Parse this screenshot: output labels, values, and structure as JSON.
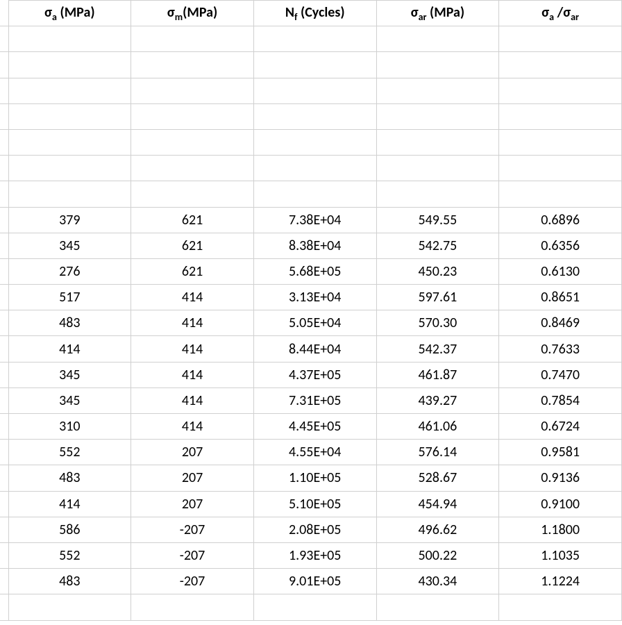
{
  "chart_data": {
    "type": "table",
    "title": "",
    "columns": [
      "σa (MPa)",
      "σm (MPa)",
      "Nf (Cycles)",
      "σar (MPa)",
      "σa/σar"
    ],
    "rows": [
      {
        "sigma_a": 379,
        "sigma_m": 621,
        "Nf": "7.38E+04",
        "sigma_ar": 549.55,
        "ratio": 0.6896
      },
      {
        "sigma_a": 345,
        "sigma_m": 621,
        "Nf": "8.38E+04",
        "sigma_ar": 542.75,
        "ratio": 0.6356
      },
      {
        "sigma_a": 276,
        "sigma_m": 621,
        "Nf": "5.68E+05",
        "sigma_ar": 450.23,
        "ratio": 0.613
      },
      {
        "sigma_a": 517,
        "sigma_m": 414,
        "Nf": "3.13E+04",
        "sigma_ar": 597.61,
        "ratio": 0.8651
      },
      {
        "sigma_a": 483,
        "sigma_m": 414,
        "Nf": "5.05E+04",
        "sigma_ar": 570.3,
        "ratio": 0.8469
      },
      {
        "sigma_a": 414,
        "sigma_m": 414,
        "Nf": "8.44E+04",
        "sigma_ar": 542.37,
        "ratio": 0.7633
      },
      {
        "sigma_a": 345,
        "sigma_m": 414,
        "Nf": "4.37E+05",
        "sigma_ar": 461.87,
        "ratio": 0.747
      },
      {
        "sigma_a": 345,
        "sigma_m": 414,
        "Nf": "7.31E+05",
        "sigma_ar": 439.27,
        "ratio": 0.7854
      },
      {
        "sigma_a": 310,
        "sigma_m": 414,
        "Nf": "4.45E+05",
        "sigma_ar": 461.06,
        "ratio": 0.6724
      },
      {
        "sigma_a": 552,
        "sigma_m": 207,
        "Nf": "4.55E+04",
        "sigma_ar": 576.14,
        "ratio": 0.9581
      },
      {
        "sigma_a": 483,
        "sigma_m": 207,
        "Nf": "1.10E+05",
        "sigma_ar": 528.67,
        "ratio": 0.9136
      },
      {
        "sigma_a": 414,
        "sigma_m": 207,
        "Nf": "5.10E+05",
        "sigma_ar": 454.94,
        "ratio": 0.91
      },
      {
        "sigma_a": 586,
        "sigma_m": -207,
        "Nf": "2.08E+05",
        "sigma_ar": 496.62,
        "ratio": 1.18
      },
      {
        "sigma_a": 552,
        "sigma_m": -207,
        "Nf": "1.93E+05",
        "sigma_ar": 500.22,
        "ratio": 1.1035
      },
      {
        "sigma_a": 483,
        "sigma_m": -207,
        "Nf": "9.01E+05",
        "sigma_ar": 430.34,
        "ratio": 1.1224
      }
    ]
  },
  "headers": {
    "h0": {
      "sym": "σ",
      "sub": "a",
      "rest": " (MPa)"
    },
    "h1": {
      "sym": "σ",
      "sub": "m",
      "rest": "(MPa)"
    },
    "h2": {
      "sym": "N",
      "sub": "f",
      "rest": " (Cycles)"
    },
    "h3": {
      "sym": "σ",
      "sub": "ar",
      "rest": " (MPa)"
    },
    "h4": {
      "syml": "σ",
      "subl": "a",
      "sep": " /",
      "symr": "σ",
      "subr": "ar"
    }
  },
  "rows": [
    {
      "c0": "379",
      "c1": "621",
      "c2": "7.38E+04",
      "c3": "549.55",
      "c4": "0.6896"
    },
    {
      "c0": "345",
      "c1": "621",
      "c2": "8.38E+04",
      "c3": "542.75",
      "c4": "0.6356"
    },
    {
      "c0": "276",
      "c1": "621",
      "c2": "5.68E+05",
      "c3": "450.23",
      "c4": "0.6130"
    },
    {
      "c0": "517",
      "c1": "414",
      "c2": "3.13E+04",
      "c3": "597.61",
      "c4": "0.8651"
    },
    {
      "c0": "483",
      "c1": "414",
      "c2": "5.05E+04",
      "c3": "570.30",
      "c4": "0.8469"
    },
    {
      "c0": "414",
      "c1": "414",
      "c2": "8.44E+04",
      "c3": "542.37",
      "c4": "0.7633"
    },
    {
      "c0": "345",
      "c1": "414",
      "c2": "4.37E+05",
      "c3": "461.87",
      "c4": "0.7470"
    },
    {
      "c0": "345",
      "c1": "414",
      "c2": "7.31E+05",
      "c3": "439.27",
      "c4": "0.7854"
    },
    {
      "c0": "310",
      "c1": "414",
      "c2": "4.45E+05",
      "c3": "461.06",
      "c4": "0.6724"
    },
    {
      "c0": "552",
      "c1": "207",
      "c2": "4.55E+04",
      "c3": "576.14",
      "c4": "0.9581"
    },
    {
      "c0": "483",
      "c1": "207",
      "c2": "1.10E+05",
      "c3": "528.67",
      "c4": "0.9136"
    },
    {
      "c0": "414",
      "c1": "207",
      "c2": "5.10E+05",
      "c3": "454.94",
      "c4": "0.9100"
    },
    {
      "c0": "586",
      "c1": "-207",
      "c2": "2.08E+05",
      "c3": "496.62",
      "c4": "1.1800"
    },
    {
      "c0": "552",
      "c1": "-207",
      "c2": "1.93E+05",
      "c3": "500.22",
      "c4": "1.1035"
    },
    {
      "c0": "483",
      "c1": "-207",
      "c2": "9.01E+05",
      "c3": "430.34",
      "c4": "1.1224"
    }
  ]
}
